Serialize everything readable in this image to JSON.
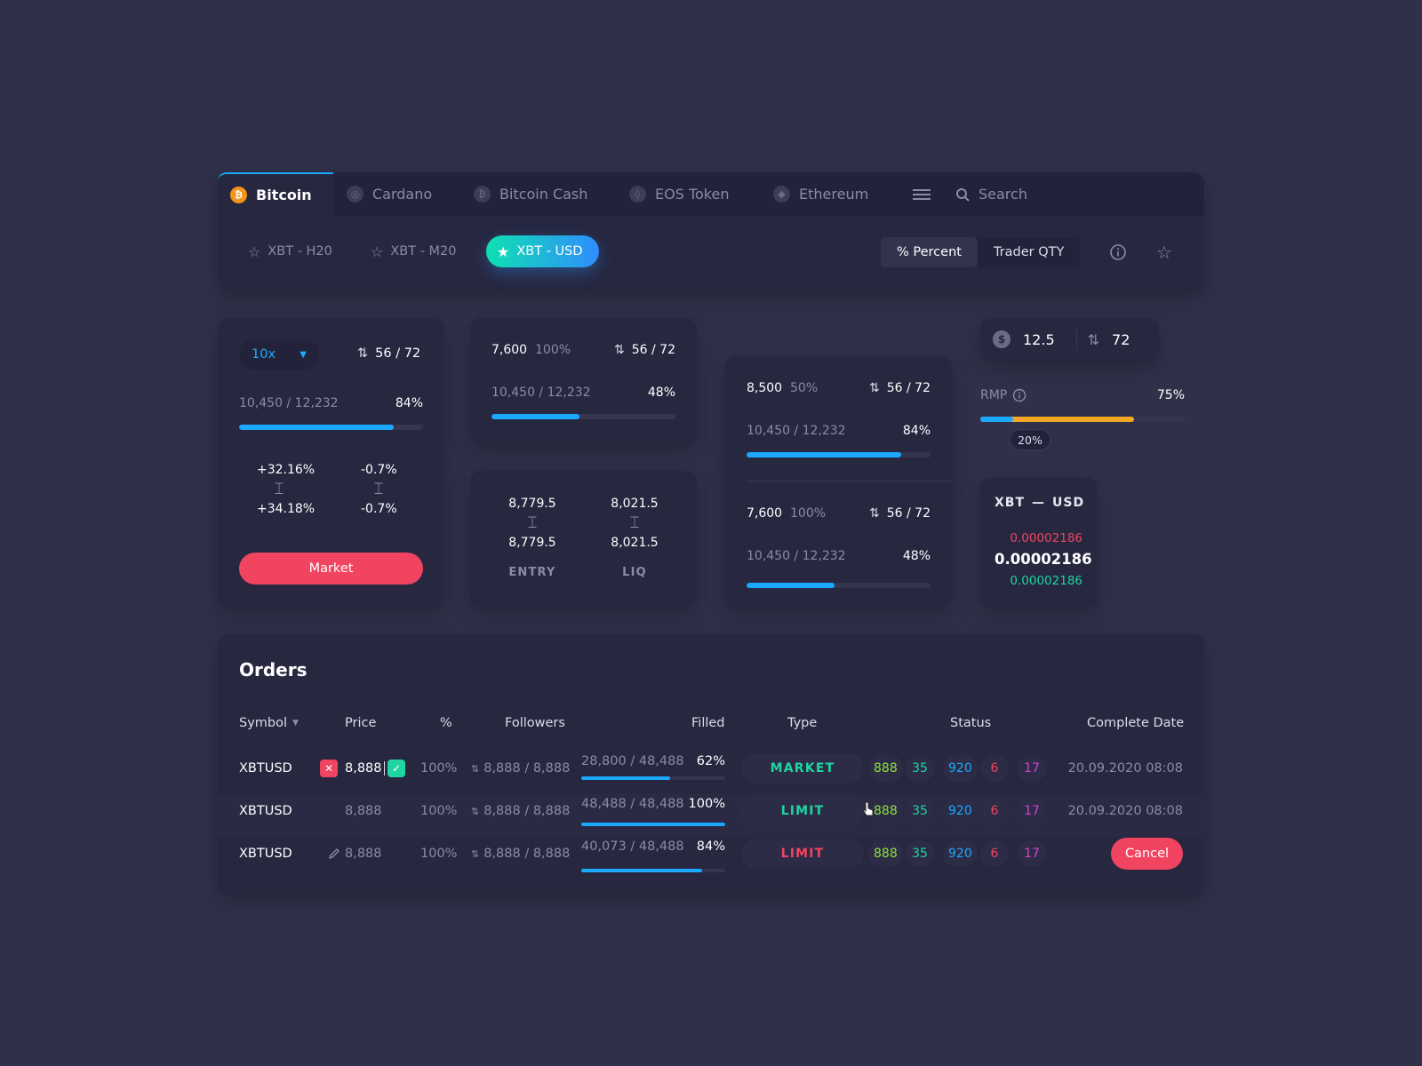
{
  "tabs": [
    {
      "label": "Bitcoin",
      "glyph": "₿",
      "active": true
    },
    {
      "label": "Cardano",
      "glyph": "◎",
      "active": false
    },
    {
      "label": "Bitcoin Cash",
      "glyph": "₿",
      "active": false
    },
    {
      "label": "EOS Token",
      "glyph": "◊",
      "active": false
    },
    {
      "label": "Ethereum",
      "glyph": "◆",
      "active": false
    }
  ],
  "search": {
    "label": "Search"
  },
  "subtabs": [
    {
      "label": "XBT - H20",
      "starred": false
    },
    {
      "label": "XBT - M20",
      "starred": false
    },
    {
      "label": "XBT - USD",
      "starred": true,
      "active": true
    }
  ],
  "toggle": {
    "percent": "% Percent",
    "trader": "Trader QTY",
    "active": "percent"
  },
  "card1": {
    "leverage": "10x",
    "ratio": "56 / 72",
    "progress_text": "10,450 / 12,232",
    "progress_pct": "84%",
    "progress": 0.84,
    "left_top": "+32.16%",
    "left_bottom": "+34.18%",
    "right_top": "-0.7%",
    "right_bottom": "-0.7%",
    "button": "Market"
  },
  "card2": {
    "value": "7,600",
    "value_pct": "100%",
    "ratio": "56 / 72",
    "progress_text": "10,450 / 12,232",
    "progress_pct": "48%",
    "progress": 0.48
  },
  "card3": {
    "entry_top": "8,779.5",
    "entry_bottom": "8,779.5",
    "liq_top": "8,021.5",
    "liq_bottom": "8,021.5",
    "entry_label": "ENTRY",
    "liq_label": "LIQ"
  },
  "card4": {
    "a": {
      "value": "8,500",
      "value_pct": "50%",
      "ratio": "56 / 72",
      "progress_text": "10,450 / 12,232",
      "progress_pct": "84%",
      "progress": 0.84
    },
    "b": {
      "value": "7,600",
      "value_pct": "100%",
      "ratio": "56 / 72",
      "progress_text": "10,450 / 12,232",
      "progress_pct": "48%",
      "progress": 0.48
    }
  },
  "mini": {
    "dollar": "12.5",
    "count": "72"
  },
  "rmp": {
    "label": "RMP",
    "pct": "75%",
    "total": 0.75,
    "blue": 0.16,
    "tooltip": "20%"
  },
  "pair": {
    "base": "XBT",
    "sep": "—",
    "quote": "USD",
    "ask": "0.00002186",
    "last": "0.00002186",
    "bid": "0.00002186"
  },
  "orders": {
    "title": "Orders",
    "headers": {
      "symbol": "Symbol",
      "price": "Price",
      "pct": "%",
      "followers": "Followers",
      "filled": "Filled",
      "type": "Type",
      "status": "Status",
      "date": "Complete Date"
    },
    "rows": [
      {
        "symbol": "XBTUSD",
        "price": "8,888",
        "pct": "100%",
        "followers": "8,888 / 8,888",
        "filled": "28,800 / 48,488",
        "filled_pct": "62%",
        "fill": 0.62,
        "type": "MARKET",
        "type_color": "#1fd6a0",
        "s1": "888",
        "s2": "35",
        "s3": "920",
        "s4": "6",
        "s5": "17",
        "date": "20.09.2020 08:08",
        "editing": true
      },
      {
        "symbol": "XBTUSD",
        "price": "8,888",
        "pct": "100%",
        "followers": "8,888 / 8,888",
        "filled": "48,488 / 48,488",
        "filled_pct": "100%",
        "fill": 1.0,
        "type": "LIMIT",
        "type_color": "#1fd6a0",
        "s1": "888",
        "s2": "35",
        "s3": "920",
        "s4": "6",
        "s5": "17",
        "date": "20.09.2020 08:08"
      },
      {
        "symbol": "XBTUSD",
        "price": "8,888",
        "pct": "100%",
        "followers": "8,888 / 8,888",
        "filled": "40,073 / 48,488",
        "filled_pct": "84%",
        "fill": 0.84,
        "type": "LIMIT",
        "type_color": "#f04460",
        "s1": "888",
        "s2": "35",
        "s3": "920",
        "s4": "6",
        "s5": "17",
        "cancel": "Cancel"
      }
    ]
  },
  "colors": {
    "accent": "#1aa9ff",
    "danger": "#f04460",
    "success": "#1fd6a0",
    "warning": "#f5a623",
    "s1": "#8ee03a",
    "s2": "#1fd6a0",
    "s3": "#1aa9ff",
    "s4": "#f04460",
    "s5": "#d43fd6"
  }
}
